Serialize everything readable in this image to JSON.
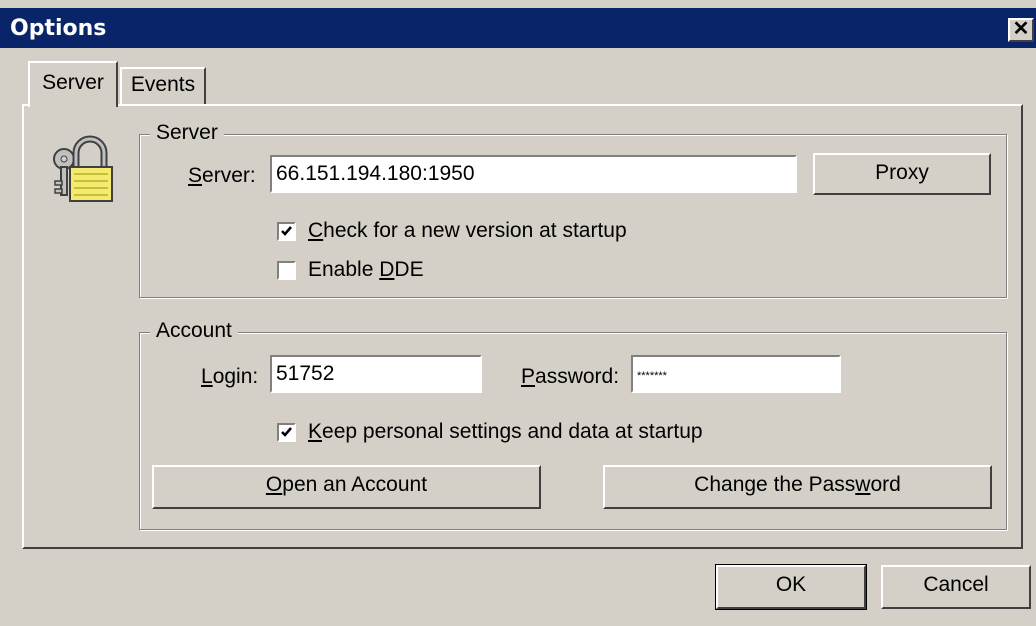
{
  "window": {
    "title": "Options",
    "close_label": "✕"
  },
  "tabs": [
    {
      "label": "Server",
      "active": true
    },
    {
      "label": "Events",
      "active": false
    }
  ],
  "server_group": {
    "legend": "Server",
    "server_label": "Server:",
    "server_value": "66.151.194.180:1950",
    "proxy_button": "Proxy",
    "check_new_version": {
      "label": "Check for a new version at startup",
      "checked": true
    },
    "enable_dde": {
      "label": "Enable DDE",
      "checked": false
    }
  },
  "account_group": {
    "legend": "Account",
    "login_label": "Login:",
    "login_value": "51752",
    "password_label": "Password:",
    "password_value": "*******",
    "keep_settings": {
      "label": "Keep personal settings and data at startup",
      "checked": true
    },
    "open_account_button": "Open an Account",
    "change_password_button": "Change the Password"
  },
  "footer": {
    "ok_button": "OK",
    "cancel_button": "Cancel"
  },
  "icons": {
    "dialog_icon": "lock-keys-icon"
  }
}
